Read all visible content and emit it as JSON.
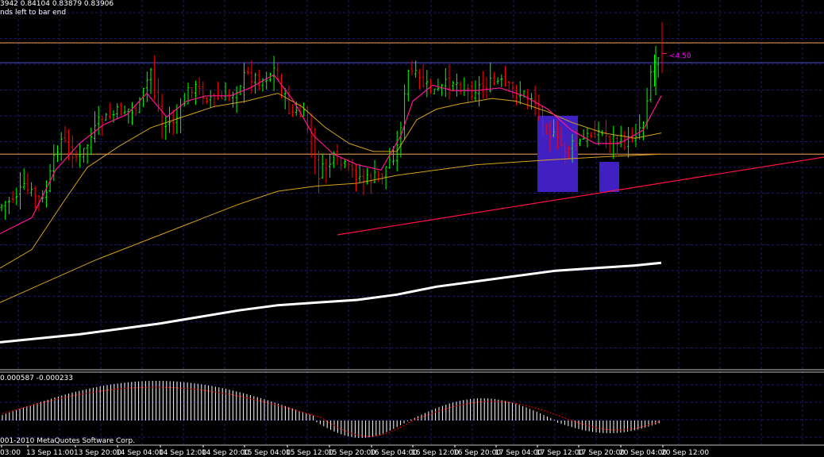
{
  "header": {
    "line1": "3942 0.84104 0.83879 0.83906",
    "line2": "nds left to bar end"
  },
  "annotation": {
    "text": "<4.50",
    "color": "#ff00ff"
  },
  "osc_header": "0.000587 -0.000233",
  "copyright": "001-2010 MetaQuotes Software Corp.",
  "colors": {
    "background": "#000000",
    "grid": "#1c1c64",
    "bull_candle": "#00ff00",
    "bear_candle": "#ff0000",
    "fast_ma": "#ff1493",
    "mid_ma": "#d4a017",
    "slow_ma": "#ffffff",
    "horizontal_levels": "#f4a460",
    "trendline": "#ff1040",
    "rectangle": "#4020c0",
    "histogram": "#ffffff",
    "signal": "#ff0000"
  },
  "chart_data": {
    "type": "line",
    "title": "",
    "xlabel": "",
    "ylabel": "",
    "grid": true,
    "x_ticks": [
      "03:00",
      "13 Sep 11:00",
      "13 Sep 20:00",
      "14 Sep 04:00",
      "14 Sep 12:00",
      "14 Sep 20:00",
      "15 Sep 04:00",
      "15 Sep 12:00",
      "15 Sep 20:00",
      "16 Sep 04:00",
      "16 Sep 12:00",
      "16 Sep 20:00",
      "17 Sep 04:00",
      "17 Sep 12:00",
      "17 Sep 20:00",
      "20 Sep 04:00",
      "20 Sep 12:00"
    ],
    "price_close_path": [
      [
        0,
        0.62
      ],
      [
        30,
        0.55
      ],
      [
        55,
        0.6
      ],
      [
        75,
        0.36
      ],
      [
        100,
        0.44
      ],
      [
        125,
        0.3
      ],
      [
        150,
        0.26
      ],
      [
        175,
        0.24
      ],
      [
        190,
        0.1
      ],
      [
        205,
        0.32
      ],
      [
        225,
        0.28
      ],
      [
        240,
        0.16
      ],
      [
        260,
        0.2
      ],
      [
        285,
        0.22
      ],
      [
        310,
        0.12
      ],
      [
        330,
        0.14
      ],
      [
        345,
        0.1
      ],
      [
        365,
        0.26
      ],
      [
        385,
        0.28
      ],
      [
        400,
        0.5
      ],
      [
        420,
        0.44
      ],
      [
        440,
        0.48
      ],
      [
        460,
        0.52
      ],
      [
        480,
        0.5
      ],
      [
        500,
        0.4
      ],
      [
        515,
        0.1
      ],
      [
        530,
        0.15
      ],
      [
        550,
        0.19
      ],
      [
        570,
        0.14
      ],
      [
        590,
        0.18
      ],
      [
        610,
        0.16
      ],
      [
        630,
        0.15
      ],
      [
        650,
        0.19
      ],
      [
        670,
        0.2
      ],
      [
        690,
        0.33
      ],
      [
        710,
        0.4
      ],
      [
        730,
        0.38
      ],
      [
        750,
        0.33
      ],
      [
        770,
        0.36
      ],
      [
        790,
        0.38
      ],
      [
        810,
        0.3
      ],
      [
        820,
        0.1
      ],
      [
        830,
        0.04
      ]
    ],
    "fast_ma_path": [
      [
        0,
        0.72
      ],
      [
        40,
        0.66
      ],
      [
        70,
        0.48
      ],
      [
        100,
        0.38
      ],
      [
        130,
        0.31
      ],
      [
        160,
        0.27
      ],
      [
        185,
        0.19
      ],
      [
        210,
        0.28
      ],
      [
        235,
        0.22
      ],
      [
        260,
        0.2
      ],
      [
        290,
        0.2
      ],
      [
        315,
        0.17
      ],
      [
        345,
        0.12
      ],
      [
        370,
        0.22
      ],
      [
        395,
        0.35
      ],
      [
        420,
        0.42
      ],
      [
        450,
        0.46
      ],
      [
        480,
        0.48
      ],
      [
        505,
        0.35
      ],
      [
        520,
        0.22
      ],
      [
        545,
        0.16
      ],
      [
        570,
        0.18
      ],
      [
        600,
        0.18
      ],
      [
        630,
        0.17
      ],
      [
        660,
        0.2
      ],
      [
        690,
        0.25
      ],
      [
        720,
        0.33
      ],
      [
        750,
        0.38
      ],
      [
        780,
        0.38
      ],
      [
        810,
        0.33
      ],
      [
        833,
        0.2
      ]
    ],
    "mid_ma_path": [
      [
        0,
        0.85
      ],
      [
        40,
        0.78
      ],
      [
        80,
        0.6
      ],
      [
        110,
        0.47
      ],
      [
        150,
        0.39
      ],
      [
        190,
        0.32
      ],
      [
        230,
        0.28
      ],
      [
        270,
        0.24
      ],
      [
        310,
        0.22
      ],
      [
        350,
        0.19
      ],
      [
        380,
        0.24
      ],
      [
        410,
        0.32
      ],
      [
        440,
        0.38
      ],
      [
        470,
        0.41
      ],
      [
        500,
        0.41
      ],
      [
        525,
        0.29
      ],
      [
        550,
        0.25
      ],
      [
        580,
        0.23
      ],
      [
        620,
        0.21
      ],
      [
        650,
        0.22
      ],
      [
        690,
        0.26
      ],
      [
        720,
        0.3
      ],
      [
        760,
        0.34
      ],
      [
        800,
        0.36
      ],
      [
        833,
        0.34
      ]
    ],
    "ma100_path": [
      [
        0,
        0.98
      ],
      [
        60,
        0.9
      ],
      [
        120,
        0.82
      ],
      [
        180,
        0.75
      ],
      [
        240,
        0.68
      ],
      [
        300,
        0.61
      ],
      [
        350,
        0.56
      ],
      [
        400,
        0.54
      ],
      [
        450,
        0.53
      ],
      [
        500,
        0.5
      ],
      [
        550,
        0.48
      ],
      [
        600,
        0.46
      ],
      [
        650,
        0.45
      ],
      [
        700,
        0.44
      ],
      [
        760,
        0.43
      ],
      [
        833,
        0.42
      ]
    ],
    "ma200_path": [
      [
        0,
        1.13
      ],
      [
        100,
        1.1
      ],
      [
        200,
        1.06
      ],
      [
        300,
        1.01
      ],
      [
        350,
        0.99
      ],
      [
        400,
        0.98
      ],
      [
        450,
        0.97
      ],
      [
        500,
        0.95
      ],
      [
        550,
        0.92
      ],
      [
        600,
        0.9
      ],
      [
        650,
        0.88
      ],
      [
        700,
        0.86
      ],
      [
        750,
        0.85
      ],
      [
        800,
        0.84
      ],
      [
        833,
        0.83
      ]
    ],
    "horizontal_levels": [
      0.0,
      0.42
    ],
    "annotation_level": 0.04
  }
}
